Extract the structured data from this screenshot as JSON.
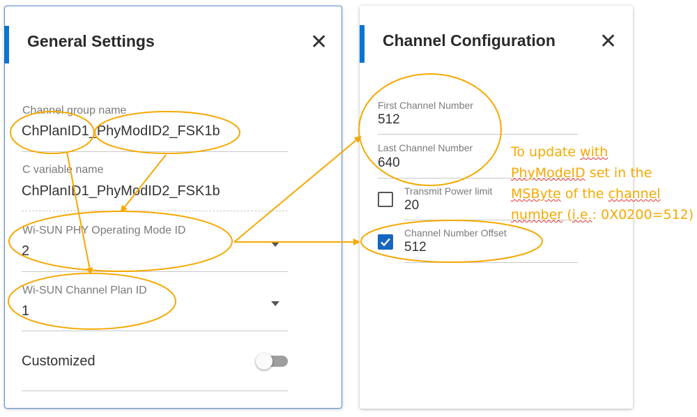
{
  "general_settings": {
    "title": "General Settings",
    "close_icon": "close-icon",
    "fields": {
      "channel_group_name": {
        "label": "Channel group name",
        "value": "ChPlanID1_PhyModID2_FSK1b"
      },
      "c_variable_name": {
        "label": "C variable name",
        "value": "ChPlanID1_PhyModID2_FSK1b"
      },
      "phy_operating_mode_id": {
        "label": "Wi-SUN PHY Operating Mode ID",
        "value": "2"
      },
      "channel_plan_id": {
        "label": "Wi-SUN Channel Plan ID",
        "value": "1"
      }
    },
    "customized": {
      "label": "Customized",
      "enabled": false
    }
  },
  "channel_configuration": {
    "title": "Channel Configuration",
    "close_icon": "close-icon",
    "fields": {
      "first_channel_number": {
        "label": "First Channel Number",
        "value": "512"
      },
      "last_channel_number": {
        "label": "Last Channel Number",
        "value": "640"
      },
      "transmit_power_limit": {
        "label": "Transmit Power limit",
        "value": "20",
        "checked": false
      },
      "channel_number_offset": {
        "label": "Channel Number Offset",
        "value": "512",
        "checked": true
      }
    }
  },
  "annotation": {
    "line1_plain": "To update ",
    "line1_ul": "with",
    "line2_ul": "PhyModeID",
    "line2_plain": " set in the",
    "line3_ul1": "MSByte",
    "line3_plain": " of the ",
    "line3_ul2": "channel",
    "line4_ul1": "number",
    "line4_plain1": " (",
    "line4_ul2": "i.e.",
    "line4_plain2": ": 0X0200=512)"
  },
  "colors": {
    "accent": "#0a74d1",
    "highlight": "#f5a800",
    "checkbox": "#1565c0"
  }
}
